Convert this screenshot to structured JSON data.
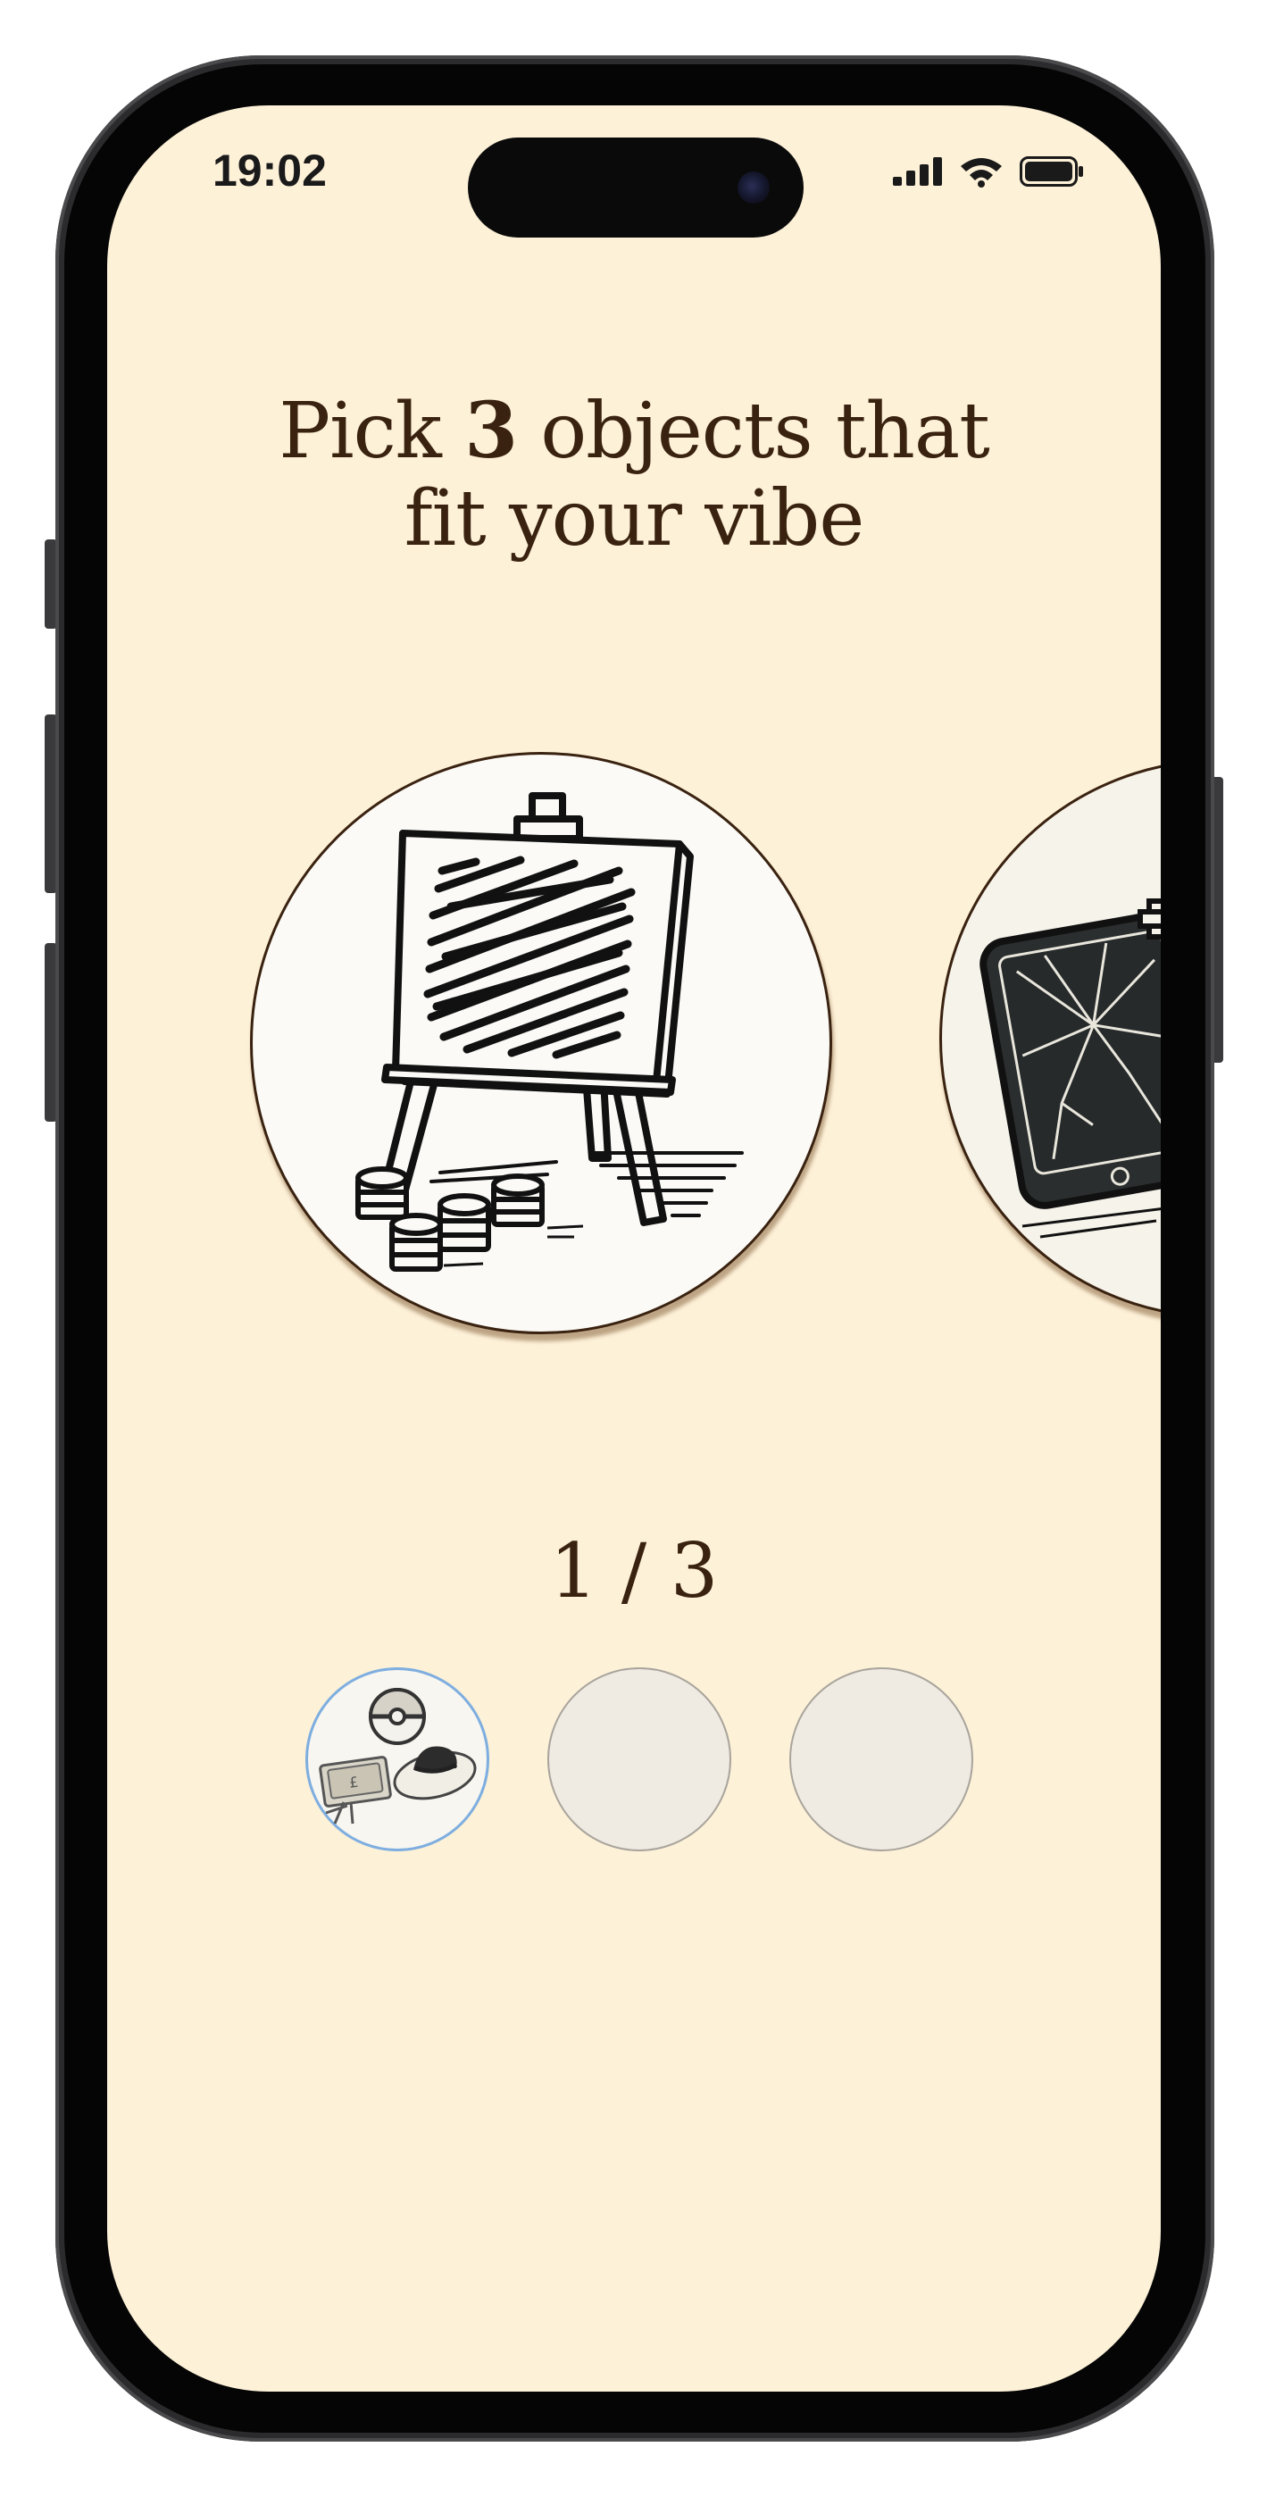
{
  "status_bar": {
    "time": "19:02",
    "icons": [
      "signal-icon",
      "wifi-icon",
      "battery-icon"
    ]
  },
  "header": {
    "title_prefix": "Pick",
    "title_count": "3",
    "title_suffix_line1": "objects that",
    "title_line2": "fit your vibe"
  },
  "carousel": {
    "items": [
      {
        "name": "easel-with-coins",
        "icon": "easel-icon"
      },
      {
        "name": "cracked-phone",
        "icon": "cracked-phone-icon"
      }
    ]
  },
  "progress": {
    "label": "1 / 3",
    "selected": 1,
    "total": 3,
    "slots": [
      {
        "filled": true,
        "icons": [
          "pokeball-icon",
          "banknote-icon",
          "hat-icon"
        ]
      },
      {
        "filled": false
      },
      {
        "filled": false
      }
    ]
  },
  "colors": {
    "background": "#fdf1d8",
    "text": "#3a2210",
    "slot_empty": "#efeae2",
    "slot_selected_border": "#7eaee0"
  }
}
